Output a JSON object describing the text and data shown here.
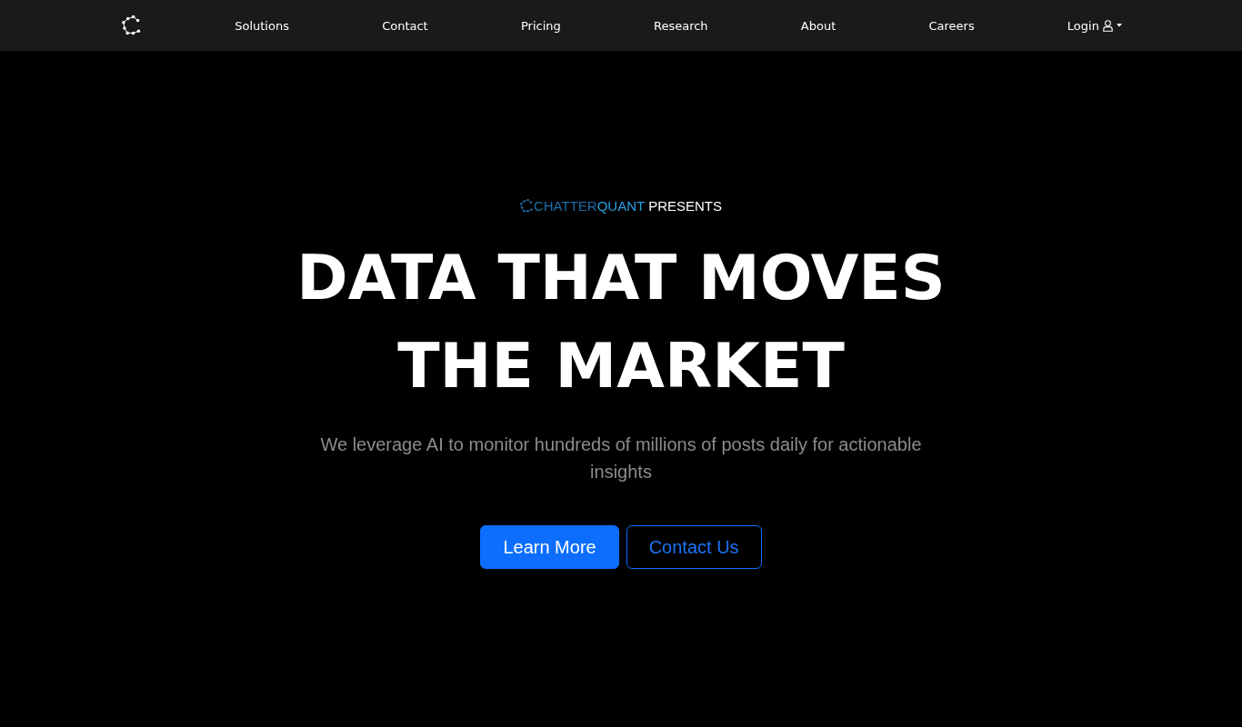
{
  "nav": {
    "items": [
      {
        "label": "Solutions"
      },
      {
        "label": "Contact"
      },
      {
        "label": "Pricing"
      },
      {
        "label": "Research"
      },
      {
        "label": "About"
      },
      {
        "label": "Careers"
      }
    ],
    "login": {
      "label": "Login"
    }
  },
  "hero": {
    "eyebrow": [
      {
        "text": "CHATTER",
        "color": "#1b6ea6"
      },
      {
        "text": "QUANT",
        "color": "#2b9fe2"
      },
      {
        "text": "PRESENTS",
        "color": "#ffffff"
      }
    ],
    "title": "DATA THAT MOVES THE MARKET",
    "subtitle": "We leverage AI to monitor hundreds of millions of posts daily for actionable insights",
    "buttons": [
      {
        "label": "Learn More",
        "kind": "primary"
      },
      {
        "label": "Contact Us",
        "kind": "outline"
      }
    ]
  }
}
